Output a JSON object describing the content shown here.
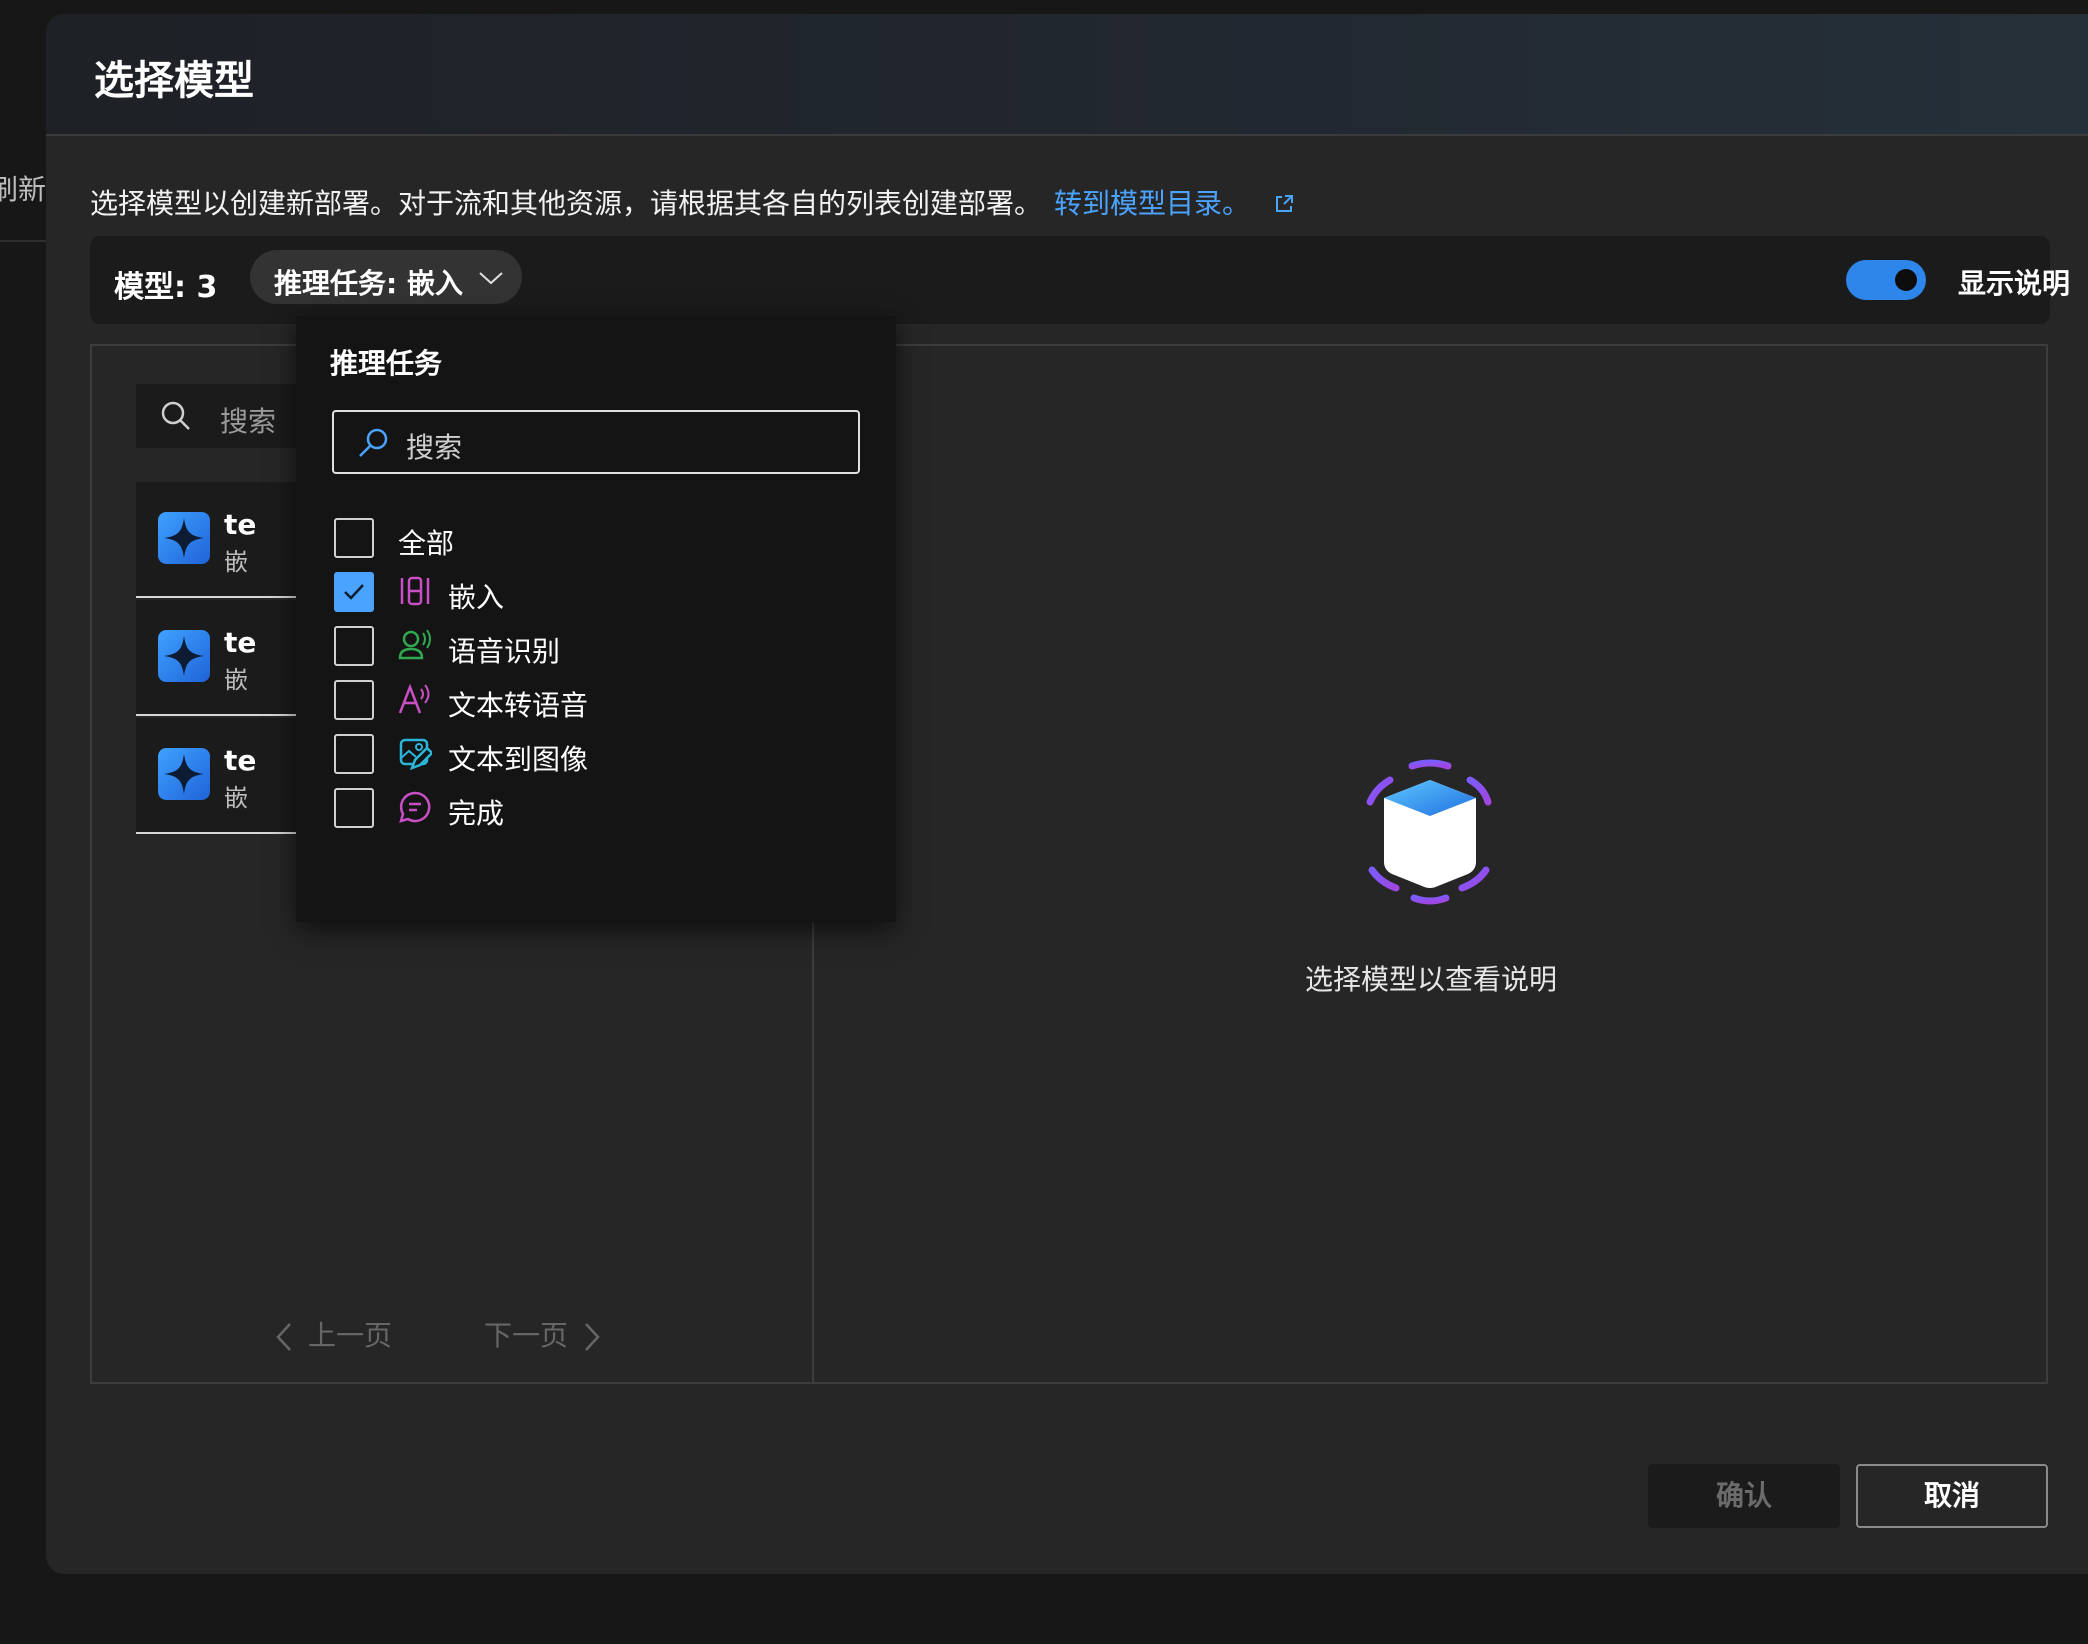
{
  "background": {
    "fragment_text": "刷新"
  },
  "dialog": {
    "title": "选择模型",
    "description": "选择模型以创建新部署。对于流和其他资源，请根据其各自的列表创建部署。",
    "catalog_link": "转到模型目录。"
  },
  "filter_bar": {
    "model_count": "模型: 3",
    "task_filter": "推理任务: 嵌入",
    "toggle_label": "显示说明",
    "toggle_on": true
  },
  "model_list": {
    "search_placeholder": "搜索",
    "items": [
      {
        "name": "te",
        "subtitle": "嵌"
      },
      {
        "name": "te",
        "subtitle": "嵌"
      },
      {
        "name": "te",
        "subtitle": "嵌"
      }
    ],
    "prev_label": "上一页",
    "next_label": "下一页"
  },
  "details": {
    "empty_text": "选择模型以查看说明"
  },
  "dropdown": {
    "title": "推理任务",
    "search_placeholder": "搜索",
    "options": [
      {
        "label": "全部",
        "checked": false,
        "icon": "none"
      },
      {
        "label": "嵌入",
        "checked": true,
        "icon": "embedding-icon"
      },
      {
        "label": "语音识别",
        "checked": false,
        "icon": "speech-icon"
      },
      {
        "label": "文本转语音",
        "checked": false,
        "icon": "text-to-speech-icon"
      },
      {
        "label": "文本到图像",
        "checked": false,
        "icon": "image-edit-icon"
      },
      {
        "label": "完成",
        "checked": false,
        "icon": "chat-icon"
      }
    ]
  },
  "buttons": {
    "confirm": "确认",
    "cancel": "取消"
  },
  "colors": {
    "accent": "#4aa3ff",
    "toggle": "#2f86ea",
    "embedding_icon": "#c94fc4",
    "speech_icon": "#2fa84f",
    "tts_icon": "#c94fc4",
    "image_icon": "#2bb6d9",
    "chat_icon": "#c94fc4"
  }
}
